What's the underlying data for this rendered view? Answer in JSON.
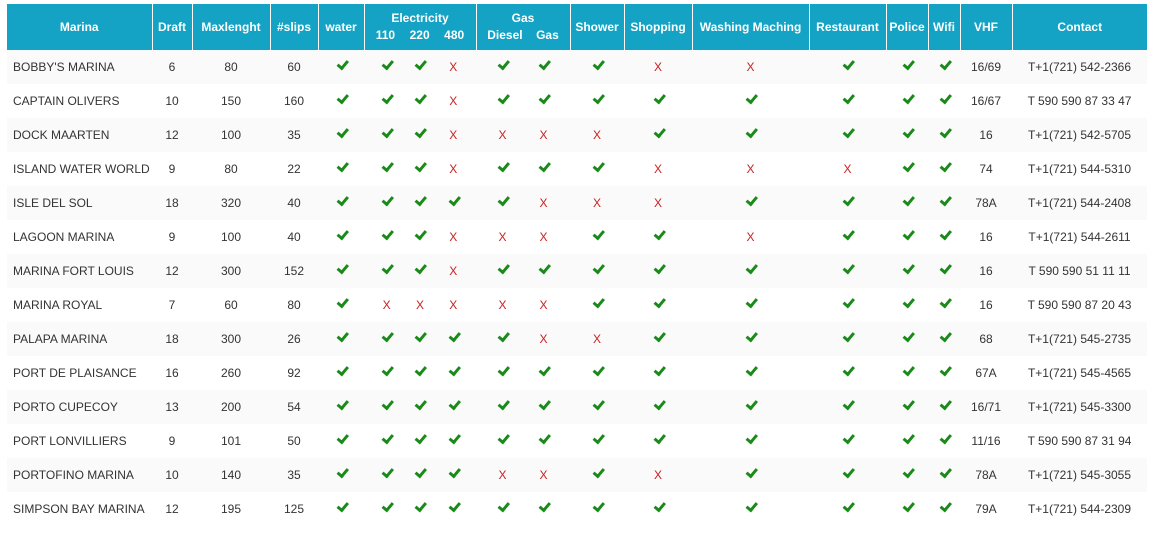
{
  "headers": {
    "marina": "Marina",
    "draft": "Draft",
    "maxlenght": "Maxlenght",
    "slips": "#slips",
    "water": "water",
    "electricity": "Electricity",
    "electricity_sub": [
      "110",
      "220",
      "480"
    ],
    "gas": "Gas",
    "gas_sub": [
      "Diesel",
      "Gas"
    ],
    "shower": "Shower",
    "shopping": "Shopping",
    "washing": "Washing Maching",
    "restaurant": "Restaurant",
    "police": "Police",
    "wifi": "Wifi",
    "vhf": "VHF",
    "contact": "Contact"
  },
  "icons": {
    "yes": "check-icon",
    "no": "x-icon"
  },
  "colors": {
    "header": "#14a3c4",
    "yes": "#1a8a1a",
    "no": "#cc1f1f"
  },
  "rows": [
    {
      "name": "BOBBY'S MARINA",
      "draft": "6",
      "max": "80",
      "slips": "60",
      "water": true,
      "e110": true,
      "e220": true,
      "e480": false,
      "diesel": true,
      "gas": true,
      "shower": true,
      "shopping": false,
      "washing": false,
      "restaurant": true,
      "police": true,
      "wifi": true,
      "vhf": "16/69",
      "contact": "T+1(721) 542-2366"
    },
    {
      "name": "CAPTAIN OLIVERS",
      "draft": "10",
      "max": "150",
      "slips": "160",
      "water": true,
      "e110": true,
      "e220": true,
      "e480": false,
      "diesel": true,
      "gas": true,
      "shower": true,
      "shopping": true,
      "washing": true,
      "restaurant": true,
      "police": true,
      "wifi": true,
      "vhf": "16/67",
      "contact": "T 590 590 87 33 47"
    },
    {
      "name": "DOCK MAARTEN",
      "draft": "12",
      "max": "100",
      "slips": "35",
      "water": true,
      "e110": true,
      "e220": true,
      "e480": false,
      "diesel": false,
      "gas": false,
      "shower": false,
      "shopping": true,
      "washing": true,
      "restaurant": true,
      "police": true,
      "wifi": true,
      "vhf": "16",
      "contact": "T+1(721) 542-5705"
    },
    {
      "name": "ISLAND WATER WORLD",
      "draft": "9",
      "max": "80",
      "slips": "22",
      "water": true,
      "e110": true,
      "e220": true,
      "e480": false,
      "diesel": true,
      "gas": true,
      "shower": true,
      "shopping": false,
      "washing": false,
      "restaurant": false,
      "police": true,
      "wifi": true,
      "vhf": "74",
      "contact": "T+1(721) 544-5310"
    },
    {
      "name": "ISLE DEL SOL",
      "draft": "18",
      "max": "320",
      "slips": "40",
      "water": true,
      "e110": true,
      "e220": true,
      "e480": true,
      "diesel": true,
      "gas": false,
      "shower": false,
      "shopping": false,
      "washing": true,
      "restaurant": true,
      "police": true,
      "wifi": true,
      "vhf": "78A",
      "contact": "T+1(721) 544-2408"
    },
    {
      "name": "LAGOON MARINA",
      "draft": "9",
      "max": "100",
      "slips": "40",
      "water": true,
      "e110": true,
      "e220": true,
      "e480": false,
      "diesel": false,
      "gas": false,
      "shower": true,
      "shopping": true,
      "washing": false,
      "restaurant": true,
      "police": true,
      "wifi": true,
      "vhf": "16",
      "contact": "T+1(721) 544-2611"
    },
    {
      "name": "MARINA FORT LOUIS",
      "draft": "12",
      "max": "300",
      "slips": "152",
      "water": true,
      "e110": true,
      "e220": true,
      "e480": false,
      "diesel": true,
      "gas": true,
      "shower": true,
      "shopping": true,
      "washing": true,
      "restaurant": true,
      "police": true,
      "wifi": true,
      "vhf": "16",
      "contact": "T 590 590 51 11 11"
    },
    {
      "name": "MARINA ROYAL",
      "draft": "7",
      "max": "60",
      "slips": "80",
      "water": true,
      "e110": false,
      "e220": false,
      "e480": false,
      "diesel": false,
      "gas": false,
      "shower": true,
      "shopping": true,
      "washing": true,
      "restaurant": true,
      "police": true,
      "wifi": true,
      "vhf": "16",
      "contact": "T 590 590 87 20 43"
    },
    {
      "name": "PALAPA MARINA",
      "draft": "18",
      "max": "300",
      "slips": "26",
      "water": true,
      "e110": true,
      "e220": true,
      "e480": true,
      "diesel": true,
      "gas": false,
      "shower": false,
      "shopping": true,
      "washing": true,
      "restaurant": true,
      "police": true,
      "wifi": true,
      "vhf": "68",
      "contact": "T+1(721) 545-2735"
    },
    {
      "name": "PORT DE PLAISANCE",
      "draft": "16",
      "max": "260",
      "slips": "92",
      "water": true,
      "e110": true,
      "e220": true,
      "e480": true,
      "diesel": true,
      "gas": true,
      "shower": true,
      "shopping": true,
      "washing": true,
      "restaurant": true,
      "police": true,
      "wifi": true,
      "vhf": "67A",
      "contact": "T+1(721) 545-4565"
    },
    {
      "name": "PORTO CUPECOY",
      "draft": "13",
      "max": "200",
      "slips": "54",
      "water": true,
      "e110": true,
      "e220": true,
      "e480": true,
      "diesel": true,
      "gas": true,
      "shower": true,
      "shopping": true,
      "washing": true,
      "restaurant": true,
      "police": true,
      "wifi": true,
      "vhf": "16/71",
      "contact": "T+1(721) 545-3300"
    },
    {
      "name": "PORT LONVILLIERS",
      "draft": "9",
      "max": "101",
      "slips": "50",
      "water": true,
      "e110": true,
      "e220": true,
      "e480": true,
      "diesel": true,
      "gas": true,
      "shower": true,
      "shopping": true,
      "washing": true,
      "restaurant": true,
      "police": true,
      "wifi": true,
      "vhf": "11/16",
      "contact": "T 590 590 87 31 94"
    },
    {
      "name": "PORTOFINO MARINA",
      "draft": "10",
      "max": "140",
      "slips": "35",
      "water": true,
      "e110": true,
      "e220": true,
      "e480": true,
      "diesel": false,
      "gas": false,
      "shower": true,
      "shopping": false,
      "washing": true,
      "restaurant": true,
      "police": true,
      "wifi": true,
      "vhf": "78A",
      "contact": "T+1(721) 545-3055"
    },
    {
      "name": "SIMPSON BAY MARINA",
      "draft": "12",
      "max": "195",
      "slips": "125",
      "water": true,
      "e110": true,
      "e220": true,
      "e480": true,
      "diesel": true,
      "gas": true,
      "shower": true,
      "shopping": true,
      "washing": true,
      "restaurant": true,
      "police": true,
      "wifi": true,
      "vhf": "79A",
      "contact": "T+1(721) 544-2309"
    }
  ]
}
